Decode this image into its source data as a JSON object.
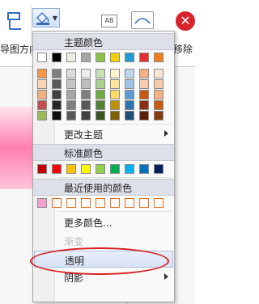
{
  "ribbon": {
    "label_left": "导图方向",
    "label_right": "移除",
    "fill_button_icon": "paint-bucket-icon",
    "remove_icon": "remove-icon",
    "ab_text": "AB"
  },
  "menu": {
    "theme_colors_header": "主题颜色",
    "theme_colors_top": [
      "#ffffff",
      "#000000",
      "#eeece1",
      "#a5a5a5",
      "#8bc34a",
      "#f4d000",
      "#1f9bd6",
      "#e03030",
      "#ee7d1b"
    ],
    "theme_colors_grid": [
      [
        "#f79646",
        "#7f7f7f",
        "#dddddd",
        "#eeeeee",
        "#c6e0b4",
        "#fff2cc",
        "#bdd7ee",
        "#f4b183",
        "#fbe5d6"
      ],
      [
        "#fbd5b5",
        "#595959",
        "#c4c4c4",
        "#bfbfbf",
        "#a9d18e",
        "#ffe699",
        "#9dc3e6",
        "#f8cbad",
        "#f8cbad"
      ],
      [
        "#f4b183",
        "#404040",
        "#a6a6a6",
        "#7f7f7f",
        "#70ad47",
        "#ffd966",
        "#5b9bd5",
        "#c55a11",
        "#f4b183"
      ],
      [
        "#c0504d",
        "#262626",
        "#808080",
        "#595959",
        "#548235",
        "#bf9000",
        "#2e75b6",
        "#8a2d0e",
        "#c55a11"
      ],
      [
        "#9bbb59",
        "#0d0d0d",
        "#595959",
        "#404040",
        "#375623",
        "#7f6000",
        "#1f4e79",
        "#5b1f0a",
        "#843c0c"
      ]
    ],
    "change_theme_label": "更改主题",
    "standard_colors_header": "标准颜色",
    "standard_colors": [
      "#c00000",
      "#ff0000",
      "#ffc000",
      "#ffff00",
      "#92d050",
      "#00b050",
      "#00b0f0",
      "#0070c0",
      "#002060"
    ],
    "recent_colors_header": "最近使用的颜色",
    "recent_colors": [
      "#f4a0d0"
    ],
    "more_colors_label": "更多颜色...",
    "gradient_label": "渐变",
    "transparent_label": "透明",
    "shadow_label": "阴影"
  }
}
